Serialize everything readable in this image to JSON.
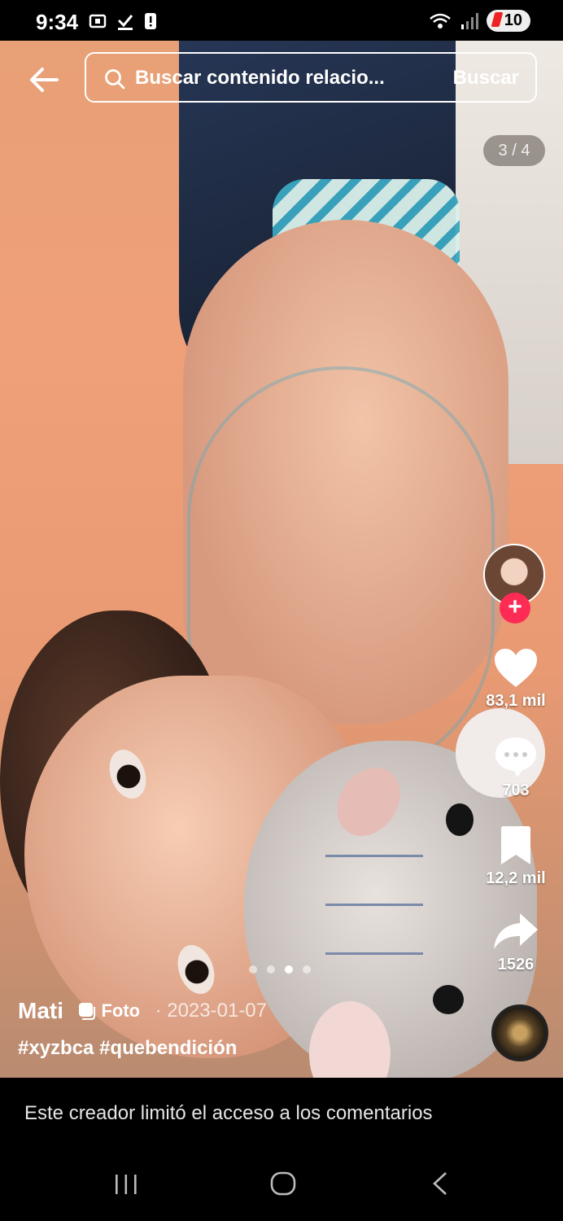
{
  "status_bar": {
    "time": "9:34",
    "battery": "10"
  },
  "header": {
    "search_placeholder": "Buscar contenido relacio...",
    "search_button": "Buscar"
  },
  "carousel": {
    "counter": "3 / 4",
    "total": 4,
    "current": 3
  },
  "actions": {
    "likes": "83,1 mil",
    "comments": "703",
    "saves": "12,2 mil",
    "shares": "1526"
  },
  "post": {
    "author": "Mati",
    "type_label": "Foto",
    "date": "· 2023-01-07",
    "hashtags": "#xyzbca #quebendición"
  },
  "footer": {
    "notice": "Este creador limitó el acceso a los comentarios"
  },
  "icons": {
    "back": "back-arrow-icon",
    "search": "search-icon",
    "follow": "plus-icon",
    "like": "heart-icon",
    "comment": "comment-icon",
    "save": "bookmark-icon",
    "share": "share-icon"
  },
  "colors": {
    "accent": "#fe2c55",
    "background": "#000000",
    "text": "#ffffff"
  }
}
